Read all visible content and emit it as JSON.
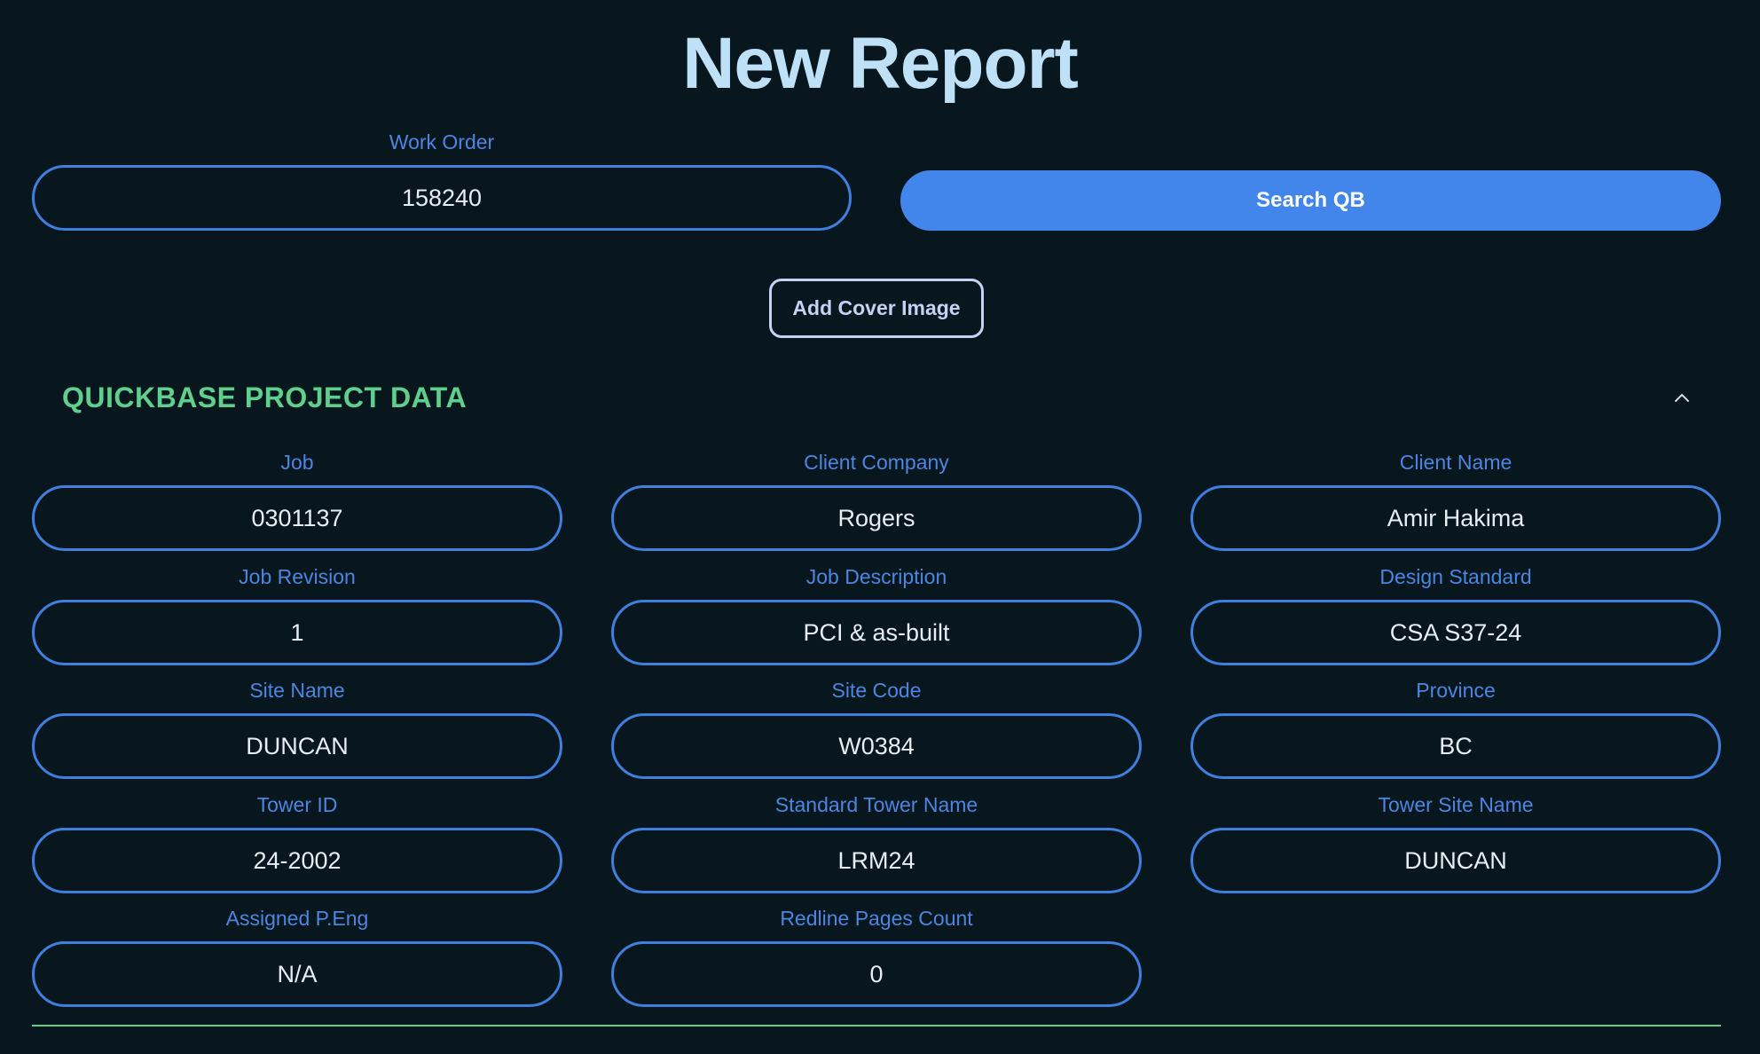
{
  "header": {
    "title": "New Report"
  },
  "work_order": {
    "label": "Work Order",
    "value": "158240"
  },
  "actions": {
    "search_label": "Search QB",
    "cover_image_label": "Add Cover Image"
  },
  "project_data": {
    "title": "QUICKBASE PROJECT DATA",
    "toggle_icon": "chevron-up-icon",
    "fields": {
      "job": {
        "label": "Job",
        "value": "0301137"
      },
      "client_company": {
        "label": "Client Company",
        "value": "Rogers"
      },
      "client_name": {
        "label": "Client Name",
        "value": "Amir Hakima"
      },
      "job_revision": {
        "label": "Job Revision",
        "value": "1"
      },
      "job_description": {
        "label": "Job Description",
        "value": "PCI & as-built"
      },
      "design_standard": {
        "label": "Design Standard",
        "value": "CSA S37-24"
      },
      "site_name": {
        "label": "Site Name",
        "value": "DUNCAN"
      },
      "site_code": {
        "label": "Site Code",
        "value": "W0384"
      },
      "province": {
        "label": "Province",
        "value": "BC"
      },
      "tower_id": {
        "label": "Tower ID",
        "value": "24-2002"
      },
      "standard_tower_name": {
        "label": "Standard Tower Name",
        "value": "LRM24"
      },
      "tower_site_name": {
        "label": "Tower Site Name",
        "value": "DUNCAN"
      },
      "assigned_peng": {
        "label": "Assigned P.Eng",
        "value": "N/A"
      },
      "redline_pages_count": {
        "label": "Redline Pages Count",
        "value": "0"
      }
    }
  },
  "colors": {
    "background": "#08161e",
    "title": "#bfe1f8",
    "label": "#4a86e2",
    "input_border": "#3f7fe0",
    "primary_button": "#4285eb",
    "section_accent": "#5fcf8d"
  }
}
